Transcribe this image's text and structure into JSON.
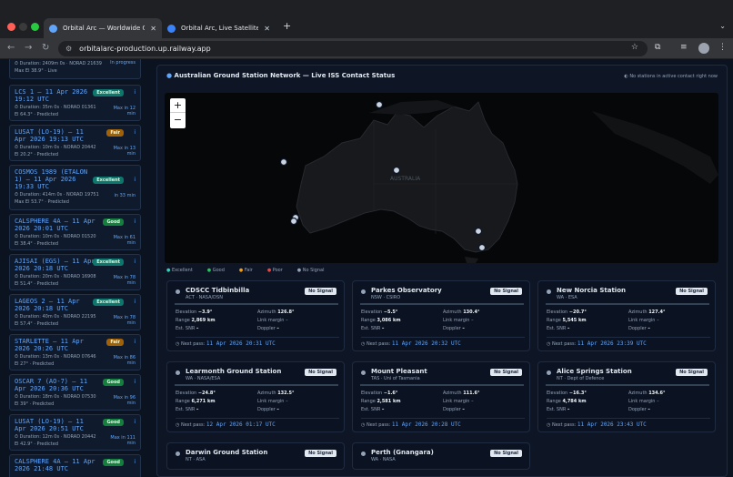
{
  "browser": {
    "tabs": [
      {
        "title": "Orbital Arc — Worldwide Grou",
        "active": true
      },
      {
        "title": "Orbital Arc, Live Satellite Pass",
        "active": false
      }
    ],
    "url": "orbitalarc-production.up.railway.app"
  },
  "passes": [
    {
      "title": "",
      "meta": "⏱ Duration: 2409m 0s · NORAD 21639",
      "meta2": "Max El 38.9° · Live",
      "badge": "",
      "badge_class": "",
      "in": "In progress"
    },
    {
      "title": "LCS 1 — 11 Apr 2026 19:12 UTC",
      "meta": "⏱ Duration: 35m 0s · NORAD 01361",
      "meta2": "El 64.3° · Predicted",
      "badge": "Excellent",
      "badge_class": "b-ex",
      "in": "Max in 12 min"
    },
    {
      "title": "LUSAT (LO-19) — 11 Apr 2026 19:13 UTC",
      "meta": "⏱ Duration: 10m 0s · NORAD 20442",
      "meta2": "El 20.2° · Predicted",
      "badge": "Fair",
      "badge_class": "b-fa",
      "in": "Max in 13 min"
    },
    {
      "title": "COSMOS 1989 (ETALON 1) — 11 Apr 2026 19:33 UTC",
      "meta": "⏱ Duration: 414m 0s · NORAD 19751",
      "meta2": "Max El 53.7° · Predicted",
      "badge": "Excellent",
      "badge_class": "b-ex",
      "in": "in 33 min"
    },
    {
      "title": "CALSPHERE 4A — 11 Apr 2026 20:01 UTC",
      "meta": "⏱ Duration: 10m 0s · NORAD 01520",
      "meta2": "El 38.4° · Predicted",
      "badge": "Good",
      "badge_class": "b-go",
      "in": "Max in 61 min"
    },
    {
      "title": "AJISAI (EGS) — 11 Apr 2026 20:18 UTC",
      "meta": "⏱ Duration: 20m 0s · NORAD 16908",
      "meta2": "El 51.4° · Predicted",
      "badge": "Excellent",
      "badge_class": "b-ex",
      "in": "Max in 78 min"
    },
    {
      "title": "LAGEOS 2 — 11 Apr 2026 20:18 UTC",
      "meta": "⏱ Duration: 40m 0s · NORAD 22195",
      "meta2": "El 57.4° · Predicted",
      "badge": "Excellent",
      "badge_class": "b-ex",
      "in": "Max in 78 min"
    },
    {
      "title": "STARLETTE — 11 Apr 2026 20:26 UTC",
      "meta": "⏱ Duration: 13m 0s · NORAD 07646",
      "meta2": "El 27° · Predicted",
      "badge": "Fair",
      "badge_class": "b-fa",
      "in": "Max in 86 min"
    },
    {
      "title": "OSCAR 7 (AO-7) — 11 Apr 2026 20:36 UTC",
      "meta": "⏱ Duration: 18m 0s · NORAD 07530",
      "meta2": "El 39° · Predicted",
      "badge": "Good",
      "badge_class": "b-go",
      "in": "Max in 96 min"
    },
    {
      "title": "LUSAT (LO-19) — 11 Apr 2026 20:51 UTC",
      "meta": "⏱ Duration: 12m 0s · NORAD 20442",
      "meta2": "El 42.9° · Predicted",
      "badge": "Good",
      "badge_class": "b-go",
      "in": "Max in 111 min"
    },
    {
      "title": "CALSPHERE 4A — 11 Apr 2026 21:48 UTC",
      "meta": "",
      "meta2": "",
      "badge": "Good",
      "badge_class": "b-go",
      "in": ""
    }
  ],
  "panel": {
    "title": "Australian Ground Station Network — Live ISS Contact Status",
    "note": "No stations in active contact right now",
    "zoom_in": "+",
    "zoom_out": "−",
    "map_label": "AUSTRALIA",
    "legend": [
      "Excellent",
      "Good",
      "Fair",
      "Poor",
      "No Signal"
    ],
    "legend_colors": [
      "#2dd4bf",
      "#22c55e",
      "#f59e0b",
      "#ef4444",
      "#94a3b8"
    ]
  },
  "stations": [
    {
      "name": "CDSCC Tidbinbilla",
      "sub": "ACT · NASA/DSN",
      "badge": "No Signal",
      "elev": "−3.9°",
      "az": "126.8°",
      "range": "2,869 km",
      "margin": "–",
      "snr": "–",
      "doppler": "–",
      "next": "11 Apr 2026 20:31 UTC"
    },
    {
      "name": "Parkes Observatory",
      "sub": "NSW · CSIRO",
      "badge": "No Signal",
      "elev": "−5.5°",
      "az": "130.4°",
      "range": "3,086 km",
      "margin": "–",
      "snr": "–",
      "doppler": "–",
      "next": "11 Apr 2026 20:32 UTC"
    },
    {
      "name": "New Norcia Station",
      "sub": "WA · ESA",
      "badge": "No Signal",
      "elev": "−20.7°",
      "az": "127.4°",
      "range": "5,545 km",
      "margin": "–",
      "snr": "–",
      "doppler": "–",
      "next": "11 Apr 2026 23:39 UTC"
    },
    {
      "name": "Learmonth Ground Station",
      "sub": "WA · NASA/ESA",
      "badge": "No Signal",
      "elev": "−24.8°",
      "az": "132.5°",
      "range": "6,271 km",
      "margin": "–",
      "snr": "–",
      "doppler": "–",
      "next": "12 Apr 2026 01:17 UTC"
    },
    {
      "name": "Mount Pleasant",
      "sub": "TAS · Uni of Tasmania",
      "badge": "No Signal",
      "elev": "−1.6°",
      "az": "111.6°",
      "range": "2,581 km",
      "margin": "–",
      "snr": "–",
      "doppler": "–",
      "next": "11 Apr 2026 20:28 UTC"
    },
    {
      "name": "Alice Springs Station",
      "sub": "NT · Dept of Defence",
      "badge": "No Signal",
      "elev": "−16.3°",
      "az": "134.6°",
      "range": "4,784 km",
      "margin": "–",
      "snr": "–",
      "doppler": "–",
      "next": "11 Apr 2026 23:43 UTC"
    },
    {
      "name": "Darwin Ground Station",
      "sub": "NT · ASA",
      "badge": "No Signal",
      "elev": "",
      "az": "",
      "range": "",
      "margin": "",
      "snr": "",
      "doppler": "",
      "next": ""
    },
    {
      "name": "Perth (Gnangara)",
      "sub": "WA · NASA",
      "badge": "No Signal",
      "elev": "",
      "az": "",
      "range": "",
      "margin": "",
      "snr": "",
      "doppler": "",
      "next": ""
    }
  ],
  "labels": {
    "elevation": "Elevation",
    "azimuth": "Azimuth",
    "range": "Range",
    "margin": "Link margin",
    "snr": "Est. SNR",
    "doppler": "Doppler",
    "next": "Next pass:"
  }
}
